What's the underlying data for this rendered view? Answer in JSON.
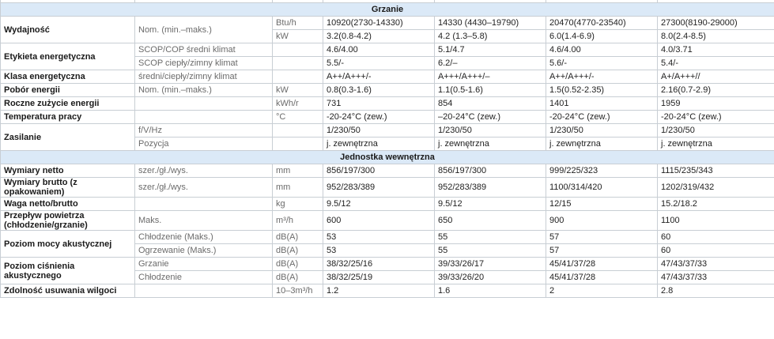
{
  "sections": {
    "heating": "Grzanie",
    "indoor": "Jednostka wewnętrzna"
  },
  "rows": {
    "capacity": {
      "label": "Wydajność",
      "sub": "Nom. (min.–maks.)",
      "r1": {
        "unit": "Btu/h",
        "v": [
          "10920(2730-14330)",
          "14330 (4430–19790)",
          "20470(4770-23540)",
          "27300(8190-29000)"
        ]
      },
      "r2": {
        "unit": "kW",
        "v": [
          "3.2(0.8-4.2)",
          "4.2 (1.3–5.8)",
          "6.0(1.4-6.9)",
          "8.0(2.4-8.5)"
        ]
      }
    },
    "energy_label": {
      "label": "Etykieta energetyczna",
      "r1": {
        "sub": "SCOP/COP średni klimat",
        "v": [
          "4.6/4.00",
          "5.1/4.7",
          "4.6/4.00",
          "4.0/3.71"
        ]
      },
      "r2": {
        "sub": "SCOP ciepły/zimny klimat",
        "v": [
          "5.5/-",
          "6.2/–",
          "5.6/-",
          "5.4/-"
        ]
      }
    },
    "energy_class": {
      "label": "Klasa energetyczna",
      "sub": "średni/ciepły/zimny klimat",
      "v": [
        "A++/A+++/-",
        "A+++/A+++/–",
        "A++/A+++/-",
        "A+/A+++//"
      ]
    },
    "power": {
      "label": "Pobór energii",
      "sub": "Nom. (min.–maks.)",
      "unit": "kW",
      "v": [
        "0.8(0.3-1.6)",
        "1.1(0.5-1.6)",
        "1.5(0.52-2.35)",
        "2.16(0.7-2.9)"
      ]
    },
    "annual": {
      "label": "Roczne zużycie energii",
      "unit": "kWh/r",
      "v": [
        "731",
        "854",
        "1401",
        "1959"
      ]
    },
    "temp": {
      "label": "Temperatura pracy",
      "unit": "°C",
      "v": [
        "-20-24°C (zew.)",
        "–20-24°C (zew.)",
        "-20-24°C (zew.)",
        "-20-24°C (zew.)"
      ]
    },
    "supply": {
      "label": "Zasilanie",
      "r1": {
        "sub": "f/V/Hz",
        "v": [
          "1/230/50",
          "1/230/50",
          "1/230/50",
          "1/230/50"
        ]
      },
      "r2": {
        "sub": "Pozycja",
        "v": [
          "j. zewnętrzna",
          "j. zewnętrzna",
          "j. zewnętrzna",
          "j. zewnętrzna"
        ]
      }
    },
    "net_dim": {
      "label": "Wymiary netto",
      "sub": "szer./gł./wys.",
      "unit": "mm",
      "v": [
        "856/197/300",
        "856/197/300",
        "999/225/323",
        "1115/235/343"
      ]
    },
    "gross_dim": {
      "label": "Wymiary brutto (z opakowaniem)",
      "sub": "szer./gł./wys.",
      "unit": "mm",
      "v": [
        "952/283/389",
        "952/283/389",
        "1100/314/420",
        "1202/319/432"
      ]
    },
    "weight": {
      "label": "Waga netto/brutto",
      "unit": "kg",
      "v": [
        "9.5/12",
        "9.5/12",
        "12/15",
        "15.2/18.2"
      ]
    },
    "airflow": {
      "label": "Przepływ powietrza (chłodzenie/grzanie)",
      "sub": "Maks.",
      "unit": "m³/h",
      "v": [
        "600",
        "650",
        "900",
        "1100"
      ]
    },
    "sound_power": {
      "label": "Poziom mocy akustycznej",
      "r1": {
        "sub": "Chłodzenie (Maks.)",
        "unit": "dB(A)",
        "v": [
          "53",
          "55",
          "57",
          "60"
        ]
      },
      "r2": {
        "sub": "Ogrzewanie (Maks.)",
        "unit": "dB(A)",
        "v": [
          "53",
          "55",
          "57",
          "60"
        ]
      }
    },
    "sound_pressure": {
      "label": "Poziom ciśnienia akustycznego",
      "r1": {
        "sub": "Grzanie",
        "unit": "dB(A)",
        "v": [
          "38/32/25/16",
          "39/33/26/17",
          "45/41/37/28",
          "47/43/37/33"
        ]
      },
      "r2": {
        "sub": "Chłodzenie",
        "unit": "dB(A)",
        "v": [
          "38/32/25/19",
          "39/33/26/20",
          "45/41/37/28",
          "47/43/37/33"
        ]
      }
    },
    "dehum": {
      "label": "Zdolność usuwania wilgoci",
      "unit": "10–3m³/h",
      "v": [
        "1.2",
        "1.6",
        "2",
        "2.8"
      ]
    }
  }
}
